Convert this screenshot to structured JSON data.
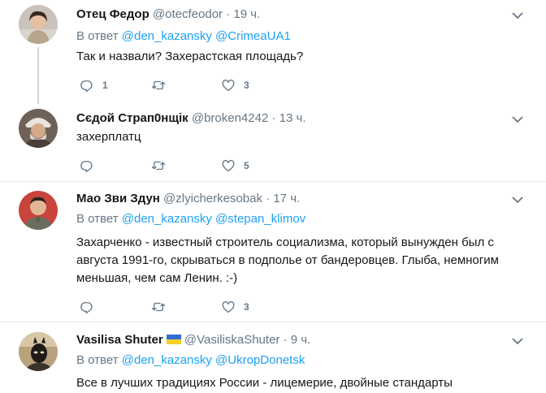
{
  "tweets": [
    {
      "name": "Отец Федор",
      "handle": "@otecfeodor",
      "dot": "·",
      "time": "19 ч.",
      "reply_prefix": "В ответ",
      "mentions": [
        "@den_kazansky",
        "@CrimeaUA1"
      ],
      "text": "Так и назвали? Захерастская площадь?",
      "reply_count": "1",
      "retweet_count": "",
      "like_count": "3"
    },
    {
      "name": "Сєдой Страп0нщік",
      "handle": "@broken4242",
      "dot": "·",
      "time": "13 ч.",
      "text": "захерплатц",
      "reply_count": "",
      "retweet_count": "",
      "like_count": "5"
    },
    {
      "name": "Мао Зви Здун",
      "handle": "@zlyicherkesobak",
      "dot": "·",
      "time": "17 ч.",
      "reply_prefix": "В ответ",
      "mentions": [
        "@den_kazansky",
        "@stepan_klimov"
      ],
      "text": "Захарченко - известный строитель социализма, который вынужден был с августа 1991-го, скрываться в подполье от бандеровцев. Глыба, немногим меньшая, чем сам Ленин. :-)",
      "reply_count": "",
      "retweet_count": "",
      "like_count": "3"
    },
    {
      "name": "Vasilisa Shuter",
      "handle": "@VasiliskaShuter",
      "dot": "·",
      "time": "9 ч.",
      "reply_prefix": "В ответ",
      "mentions": [
        "@den_kazansky",
        "@UkropDonetsk"
      ],
      "text": "Все в лучших традициях России - лицемерие, двойные стандарты"
    }
  ],
  "colors": {
    "link": "#1da1f2",
    "secondary": "#657786",
    "separator": "#e6ecf0",
    "thread_line": "#ccd6dd"
  },
  "icons": [
    "reply-icon",
    "retweet-icon",
    "like-icon",
    "chevron-down-icon",
    "ukraine-flag-icon"
  ]
}
